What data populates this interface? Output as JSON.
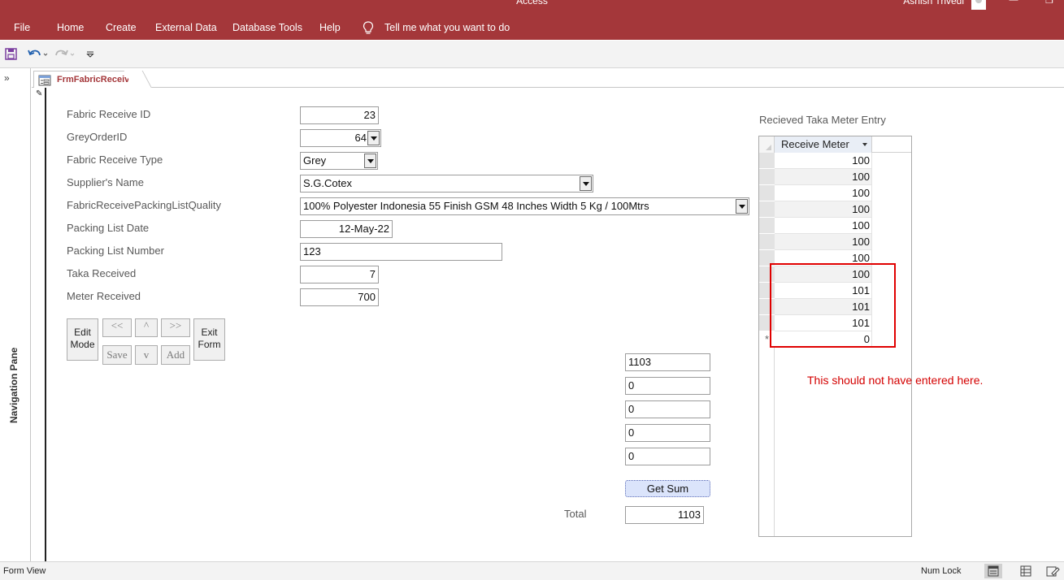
{
  "window": {
    "app_title": "Access",
    "user_name": "Ashish Trivedi",
    "min_glyph": "—",
    "max_glyph": "❐"
  },
  "menu": {
    "items": [
      "File",
      "Home",
      "Create",
      "External Data",
      "Database Tools",
      "Help"
    ],
    "tell_me": "Tell me what you want to do"
  },
  "nav": {
    "expand_glyph": "»",
    "label": "Navigation Pane"
  },
  "doc_tab": {
    "label": "FrmFabricReceive"
  },
  "form": {
    "fields": [
      {
        "label": "Fabric Receive ID",
        "value": "23"
      },
      {
        "label": "GreyOrderID",
        "value": "64"
      },
      {
        "label": "Fabric Receive Type",
        "value": "Grey"
      },
      {
        "label": "Supplier's Name",
        "value": "S.G.Cotex"
      },
      {
        "label": "FabricReceivePackingListQuality",
        "value": "100% Polyester Indonesia 55 Finish GSM 48 Inches Width 5 Kg / 100Mtrs"
      },
      {
        "label": "Packing List Date",
        "value": "12-May-22"
      },
      {
        "label": "Packing List Number",
        "value": "123"
      },
      {
        "label": "Taka Received",
        "value": "7"
      },
      {
        "label": "Meter Received",
        "value": "700"
      }
    ],
    "buttons": {
      "edit_mode": "Edit Mode",
      "first": "<<",
      "prev": "^",
      "last": ">>",
      "exit_form": "Exit Form",
      "save": "Save",
      "next": "v",
      "add": "Add"
    },
    "sum_fields": [
      "1103",
      "0",
      "0",
      "0",
      "0"
    ],
    "get_sum_label": "Get Sum",
    "total_label": "Total",
    "total_value": "1103"
  },
  "subform": {
    "title": "Recieved Taka Meter Entry",
    "column": "Receive Meter",
    "rows": [
      "100",
      "100",
      "100",
      "100",
      "100",
      "100",
      "100",
      "100",
      "101",
      "101",
      "101"
    ],
    "new_row_value": "0",
    "new_row_glyph": "*"
  },
  "annotation": {
    "text": "This should not have entered here.",
    "color": "#e00000"
  },
  "status": {
    "view": "Form View",
    "num_lock": "Num Lock"
  },
  "colors": {
    "ribbon": "#a4373a",
    "accent_text": "#a4373a"
  }
}
